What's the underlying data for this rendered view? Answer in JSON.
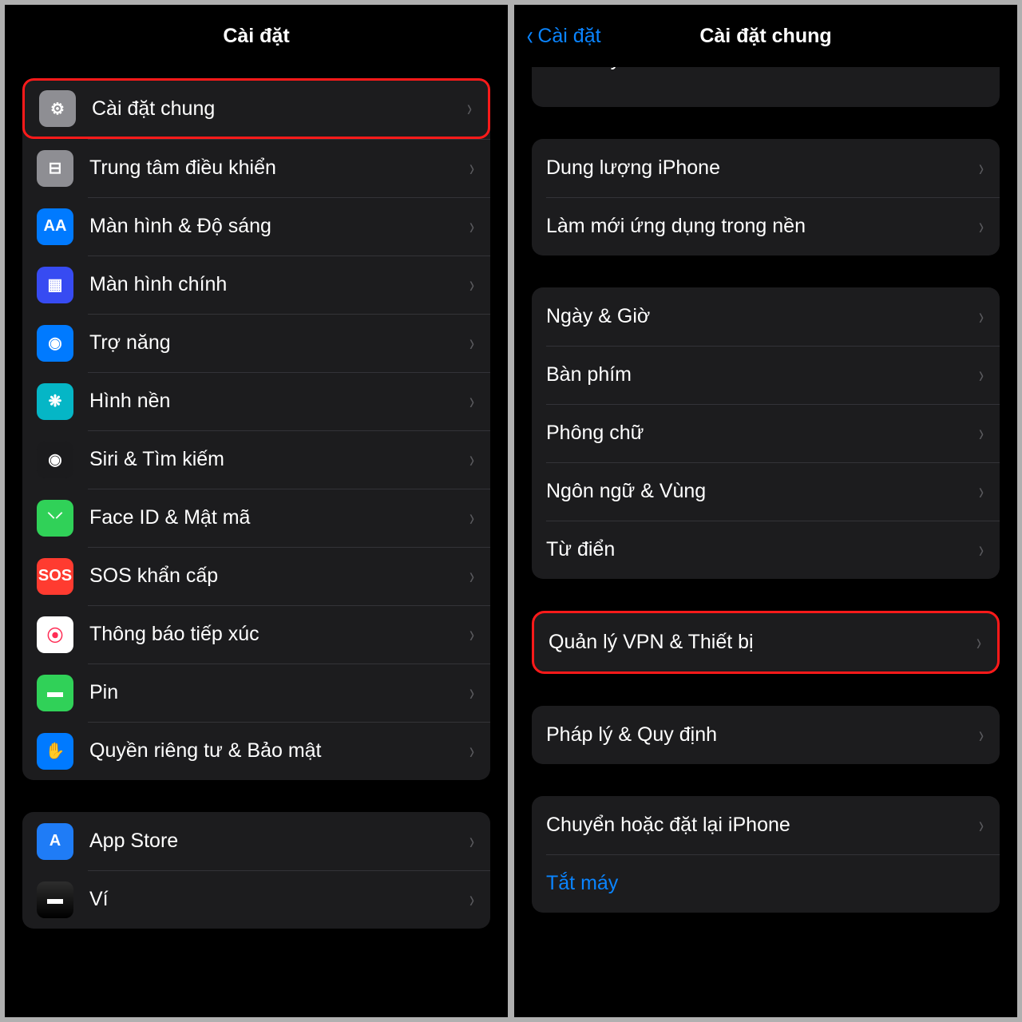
{
  "left": {
    "title": "Cài đặt",
    "group1": [
      {
        "icon": "gear",
        "bg": "bg-gray",
        "label": "Cài đặt chung",
        "hl": true
      },
      {
        "icon": "switches",
        "bg": "bg-gray2",
        "label": "Trung tâm điều khiển"
      },
      {
        "icon": "AA",
        "bg": "bg-blue",
        "label": "Màn hình & Độ sáng"
      },
      {
        "icon": "grid",
        "bg": "bg-indigo",
        "label": "Màn hình chính"
      },
      {
        "icon": "access",
        "bg": "bg-blue",
        "label": "Trợ năng"
      },
      {
        "icon": "flower",
        "bg": "bg-cyan",
        "label": "Hình nền"
      },
      {
        "icon": "siri",
        "bg": "bg-black",
        "label": "Siri & Tìm kiếm"
      },
      {
        "icon": "faceid",
        "bg": "bg-green",
        "label": "Face ID & Mật mã"
      },
      {
        "icon": "SOS",
        "bg": "bg-sos",
        "label": "SOS khẩn cấp"
      },
      {
        "icon": "exposure",
        "bg": "bg-white",
        "label": "Thông báo tiếp xúc"
      },
      {
        "icon": "battery",
        "bg": "bg-battery",
        "label": "Pin"
      },
      {
        "icon": "hand",
        "bg": "bg-privacy",
        "label": "Quyền riêng tư & Bảo mật"
      }
    ],
    "group2": [
      {
        "icon": "appstore",
        "bg": "bg-appstore",
        "label": "App Store"
      },
      {
        "icon": "wallet",
        "bg": "bg-wallet",
        "label": "Ví"
      }
    ]
  },
  "right": {
    "back": "Cài đặt",
    "title": "Cài đặt chung",
    "partial": "Cam tay",
    "g1": [
      "Dung lượng iPhone",
      "Làm mới ứng dụng trong nền"
    ],
    "g2": [
      "Ngày & Giờ",
      "Bàn phím",
      "Phông chữ",
      "Ngôn ngữ & Vùng",
      "Từ điển"
    ],
    "g3": [
      {
        "label": "Quản lý VPN & Thiết bị",
        "hl": true
      }
    ],
    "g4": [
      "Pháp lý & Quy định"
    ],
    "g5": [
      {
        "label": "Chuyển hoặc đặt lại iPhone"
      },
      {
        "label": "Tắt máy",
        "blue": true,
        "nochev": true
      }
    ]
  }
}
